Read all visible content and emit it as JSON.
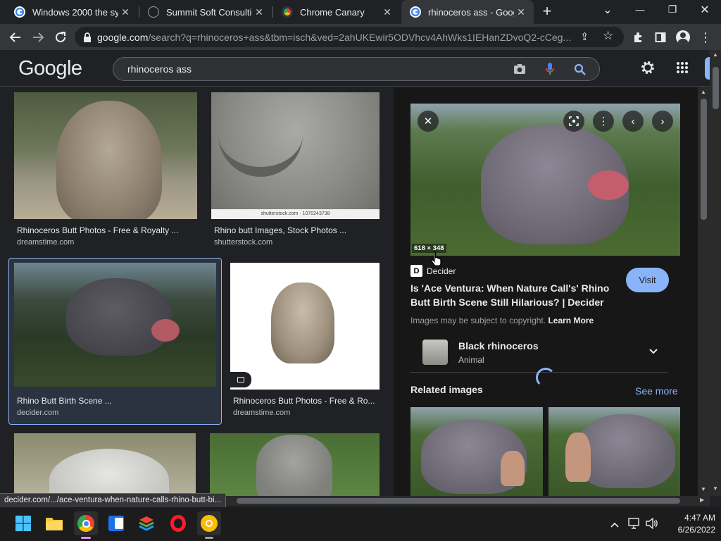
{
  "tabs": [
    {
      "label": "Windows 2000 the syst",
      "favicon_color": "#4285f4"
    },
    {
      "label": "Summit Soft Consultinc",
      "favicon_color": "#9aa0a6"
    },
    {
      "label": "Chrome Canary",
      "favicon_color": "#fbbc04"
    },
    {
      "label": "rhinoceros ass - Googl",
      "favicon_color": "#4285f4"
    }
  ],
  "new_tab_label": "+",
  "window": {
    "minimize": "—",
    "restore": "❐",
    "close": "✕",
    "tab_search": "⌄"
  },
  "address": {
    "host": "google.com",
    "path": "/search?q=rhinoceros+ass&tbm=isch&ved=2ahUKEwir5ODVhcv4AhWks1IEHanZDvoQ2-cCeg..."
  },
  "google": {
    "logo": "Google",
    "query": "rhinoceros ass"
  },
  "results": [
    {
      "title": "Rhinoceros Butt Photos - Free & Royalty ...",
      "source": "dreamstime.com"
    },
    {
      "title": "Rhino butt Images, Stock Photos ...",
      "source": "shutterstock.com",
      "watermark": "shutterstock.com · 1070243738"
    },
    {
      "title": "Rhino Butt Birth Scene ...",
      "source": "decider.com"
    },
    {
      "title": "Rhinoceros Butt Photos - Free & Ro...",
      "source": "dreamstime.com"
    }
  ],
  "panel": {
    "dimensions": "618 × 348",
    "site": "Decider",
    "site_initial": "D",
    "title_line1": "Is 'Ace Ventura: When Nature Call's' Rhino",
    "title_line2": "Butt Birth Scene Still Hilarious? | Decider",
    "copyright": "Images may be subject to copyright.",
    "learn_more": "Learn More",
    "visit": "Visit",
    "entity_name": "Black rhinoceros",
    "entity_type": "Animal",
    "related_heading": "Related images",
    "see_more": "See more"
  },
  "status_url": "decider.com/.../ace-ventura-when-nature-calls-rhino-butt-bi...",
  "clock": {
    "time": "4:47 AM",
    "date": "6/26/2022"
  },
  "colors": {
    "accent_blue": "#8ab4f8",
    "visit_bg": "#8ab4f8",
    "selected_border": "#8ab4f8"
  }
}
